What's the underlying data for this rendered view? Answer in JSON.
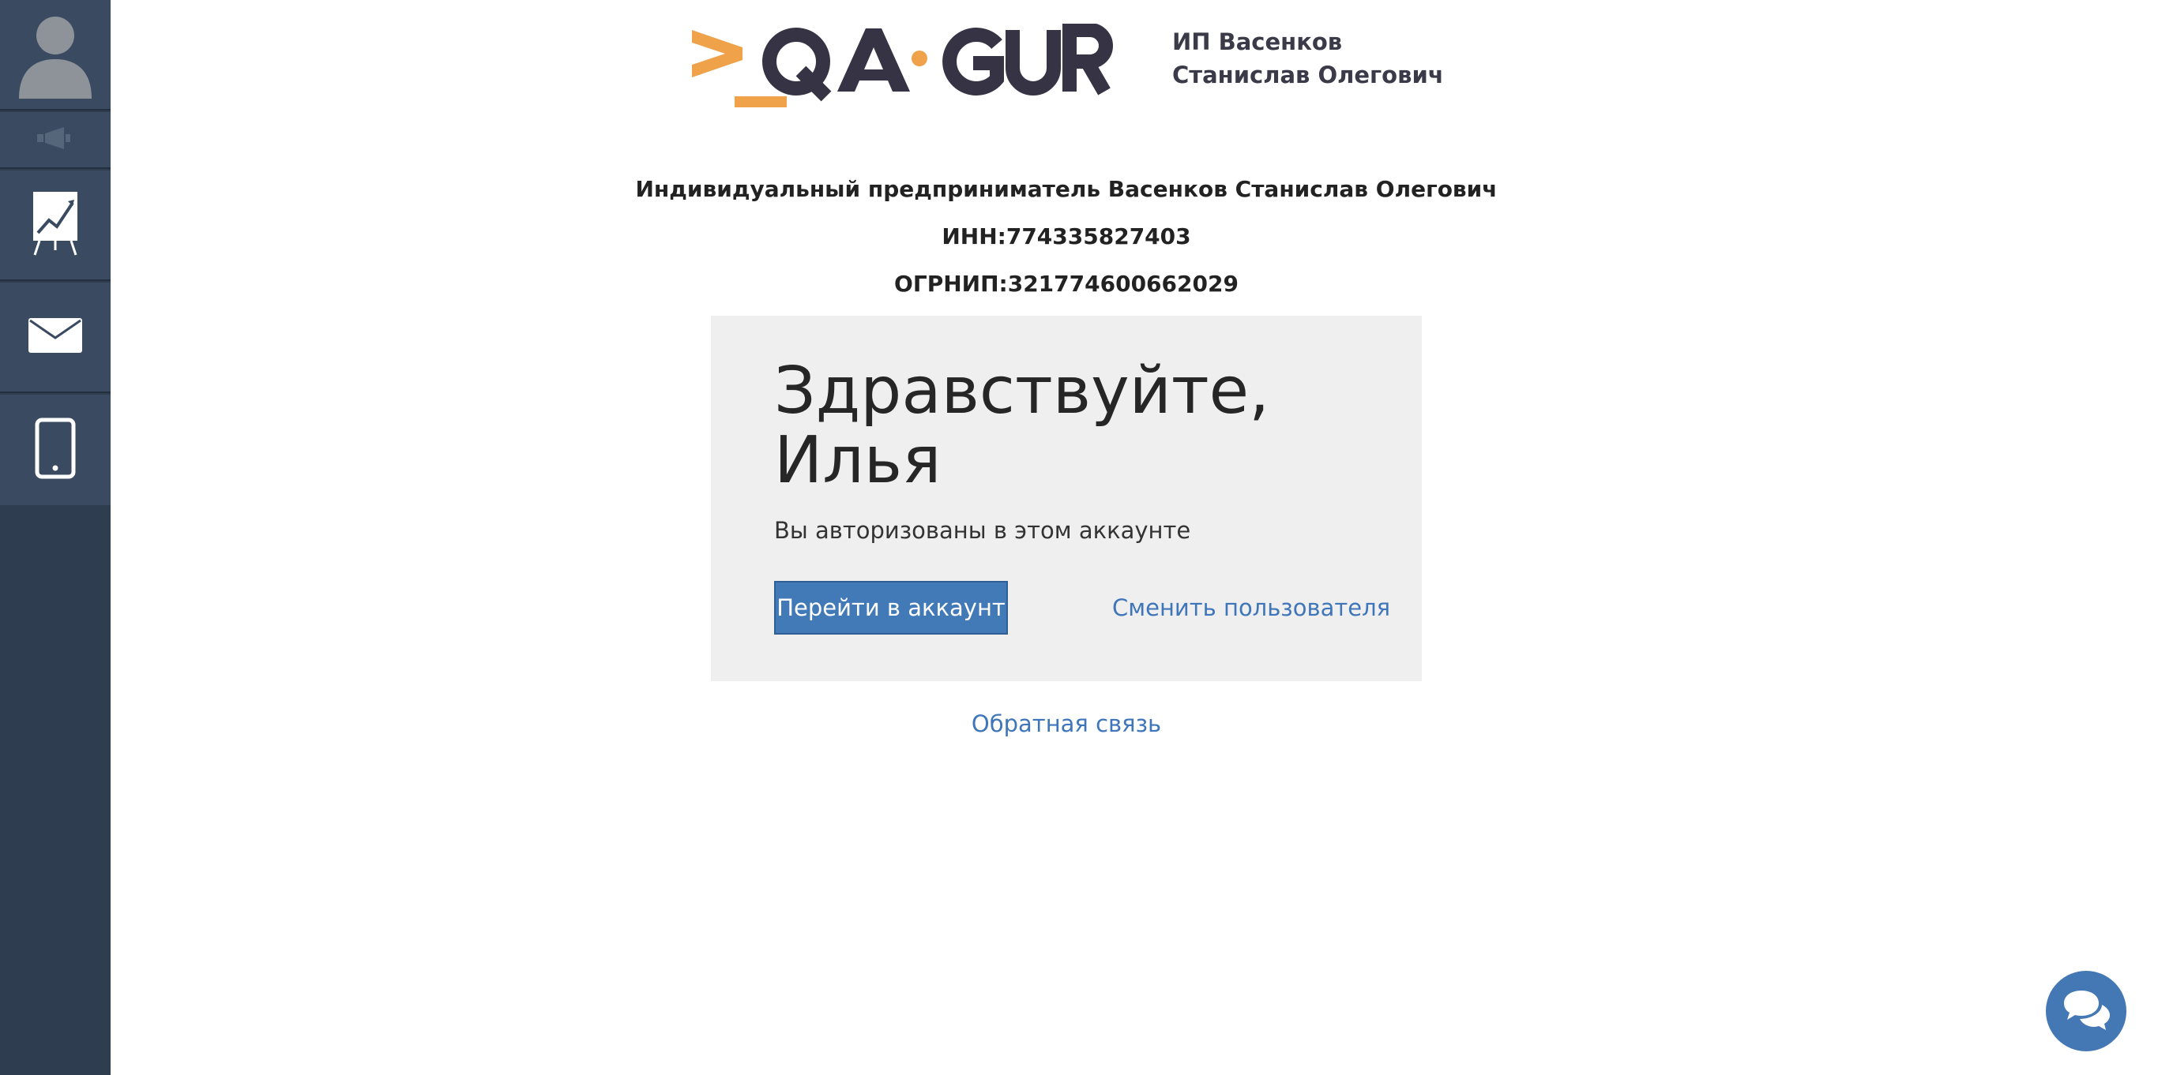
{
  "sidebar": {
    "icons": [
      "user-avatar-icon",
      "megaphone-icon",
      "chart-board-icon",
      "mail-icon",
      "phone-icon"
    ]
  },
  "header": {
    "logo_text": "_QA·GURU",
    "legal_name_line1": "ИП Васенков",
    "legal_name_line2": "Станислав Олегович"
  },
  "company": {
    "full_name": "Индивидуальный предприниматель Васенков Станислав Олегович",
    "inn": "ИНН:774335827403",
    "ogrnip": "ОГРНИП:321774600662029"
  },
  "card": {
    "greeting_line1": "Здравствуйте,",
    "greeting_line2": "Илья",
    "subtext": "Вы авторизованы в этом аккаунте",
    "go_to_account_label": "Перейти в аккаунт",
    "switch_user_label": "Сменить пользователя"
  },
  "footer": {
    "feedback_label": "Обратная связь"
  },
  "colors": {
    "sidebar_bg": "#2f3d50",
    "accent_orange": "#f0a24a",
    "brand_dark": "#353344",
    "button_blue": "#427ab8",
    "link_blue": "#3f76ba"
  }
}
